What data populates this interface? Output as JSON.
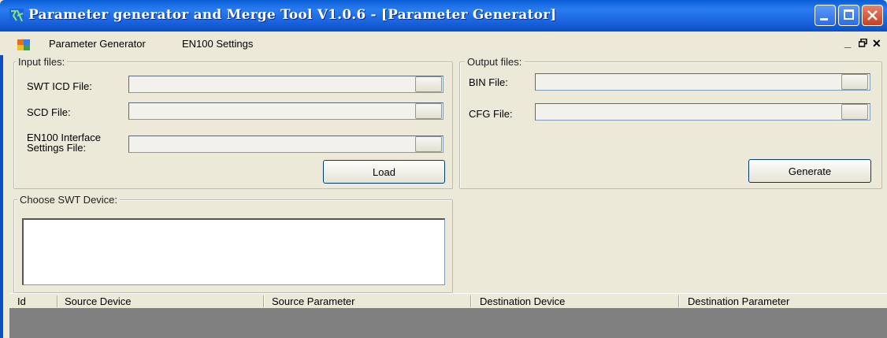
{
  "window": {
    "title": "Parameter generator and Merge Tool V1.0.6 - [Parameter Generator]",
    "icons": {
      "app": "app-icon",
      "minimize": "minimize-icon",
      "maximize": "maximize-icon",
      "close": "close-icon"
    }
  },
  "menubar": {
    "items": [
      {
        "label": "Parameter Generator",
        "icon": "document-icon"
      },
      {
        "label": "EN100 Settings"
      }
    ],
    "mdi_controls": {
      "minimize": "_",
      "restore": "🗗",
      "close": "✕"
    }
  },
  "input_files": {
    "group_label": "Input files:",
    "fields": [
      {
        "label": "SWT ICD File:",
        "value": ""
      },
      {
        "label": "SCD File:",
        "value": ""
      },
      {
        "label": "EN100 Interface\nSettings File:",
        "value": ""
      }
    ],
    "load_label": "Load"
  },
  "output_files": {
    "group_label": "Output files:",
    "fields": [
      {
        "label": "BIN File:",
        "value": ""
      },
      {
        "label": "CFG File:",
        "value": ""
      }
    ],
    "generate_label": "Generate"
  },
  "device_chooser": {
    "group_label": "Choose SWT Device:",
    "items": []
  },
  "grid": {
    "columns": [
      "Id",
      "Source Device",
      "Source Parameter",
      "Destination Device",
      "Destination Parameter"
    ],
    "rows": []
  },
  "colors": {
    "titlebar": "#1a63de",
    "face": "#ece9d8",
    "grid_bg": "#808080"
  }
}
